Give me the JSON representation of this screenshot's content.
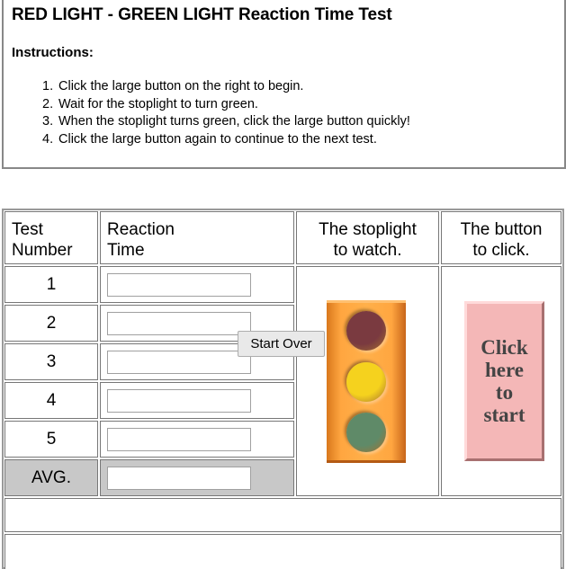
{
  "instructions": {
    "title": "RED LIGHT - GREEN LIGHT Reaction Time Test",
    "heading": "Instructions:",
    "steps": [
      {
        "num": "1.",
        "text": "Click the large button on the right to begin."
      },
      {
        "num": "2.",
        "text": "Wait for the stoplight to turn green."
      },
      {
        "num": "3.",
        "text": "When the stoplight turns green, click the large button quickly!"
      },
      {
        "num": "4.",
        "text": "Click the large button again to continue to the next test."
      }
    ]
  },
  "table": {
    "headers": {
      "test_number": [
        "Test",
        "Number"
      ],
      "reaction_time": [
        "Reaction",
        "Time"
      ],
      "stoplight": [
        "The stoplight",
        "to watch."
      ],
      "button": [
        "The button",
        "to click."
      ]
    },
    "rows": [
      {
        "label": "1",
        "value": ""
      },
      {
        "label": "2",
        "value": ""
      },
      {
        "label": "3",
        "value": ""
      },
      {
        "label": "4",
        "value": ""
      },
      {
        "label": "5",
        "value": ""
      }
    ],
    "average": {
      "label": "AVG.",
      "value": ""
    }
  },
  "stoplight": {
    "lamps": [
      {
        "name": "red-lamp",
        "color": "#7a3a40",
        "state": "off"
      },
      {
        "name": "yellow-lamp",
        "color": "#f5d21e",
        "state": "on"
      },
      {
        "name": "green-lamp",
        "color": "#5f8a68",
        "state": "off"
      }
    ],
    "housing_color": "#ffa640"
  },
  "start_button": {
    "lines": [
      "Click",
      "here",
      "to",
      "start"
    ],
    "color": "#f4b7b7"
  },
  "start_over_label": "Start Over"
}
